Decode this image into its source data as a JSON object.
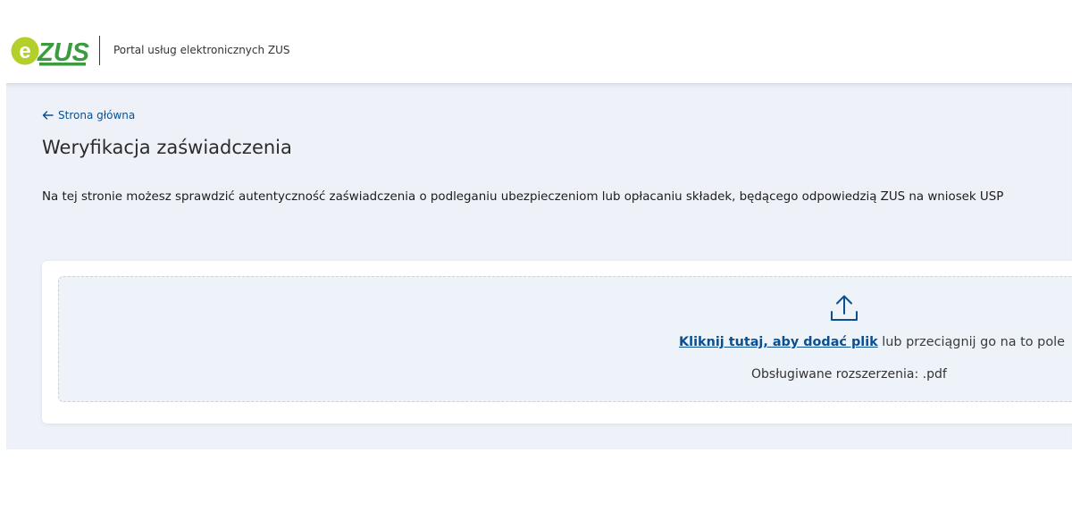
{
  "header": {
    "logo_text": "eZUS",
    "portal_name": "Portal usług elektronicznych ZUS"
  },
  "main": {
    "back_link": "Strona główna",
    "title": "Weryfikacja zaświadczenia",
    "description": "Na tej stronie możesz sprawdzić autentyczność zaświadczenia o podleganiu ubezpieczeniom lub opłacaniu składek, będącego odpowiedzią ZUS na wniosek USP"
  },
  "upload": {
    "icon": "upload-icon",
    "link_text": "Kliknij tutaj, aby dodać plik",
    "rest_text": " lub przeciągnij go na to pole",
    "extensions_label": "Obsługiwane rozszerzenia: .pdf"
  },
  "colors": {
    "brand_green": "#3a9b3f",
    "brand_lime": "#b3cf2a",
    "link_blue": "#0b4f91",
    "page_background": "#eef2f8"
  }
}
